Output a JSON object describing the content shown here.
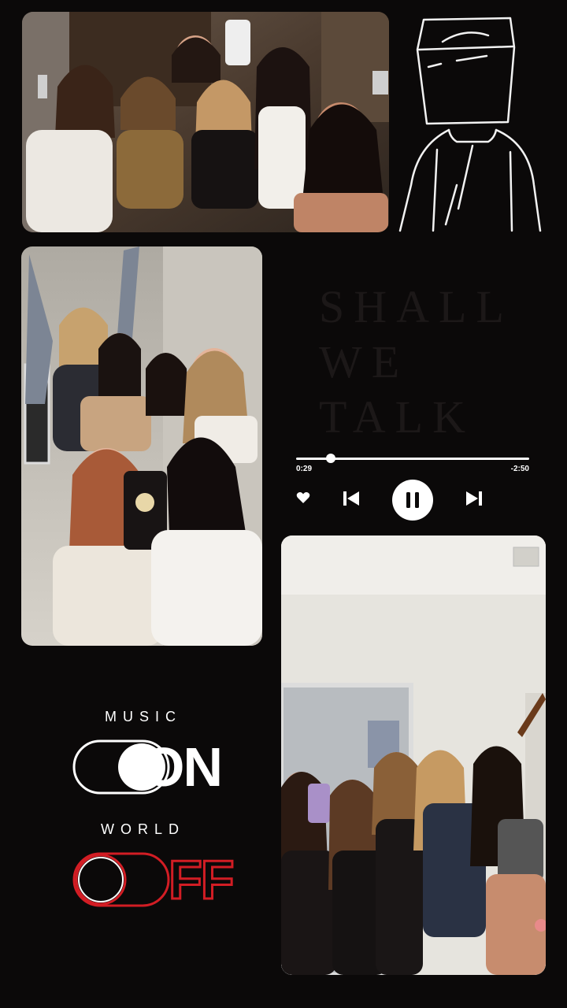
{
  "collage": {
    "photos": [
      {
        "name": "group-selfie-top"
      },
      {
        "name": "group-mirror-selfie-left"
      },
      {
        "name": "group-bathroom-selfie-right"
      }
    ],
    "background_color": "#0b0909"
  },
  "watermark_text": [
    "SHALL",
    "WE",
    "TALK"
  ],
  "player": {
    "current_time": "0:29",
    "remaining_time": "-2:50",
    "progress": 0.15,
    "state": "playing",
    "icons": [
      "heart-icon",
      "previous-icon",
      "pause-icon",
      "next-icon"
    ]
  },
  "toggles": {
    "music": {
      "label": "MUSIC",
      "state_text": "ON",
      "color": "#ffffff"
    },
    "world": {
      "label": "WORLD",
      "state_text": "FF",
      "color": "#d21d24"
    }
  }
}
